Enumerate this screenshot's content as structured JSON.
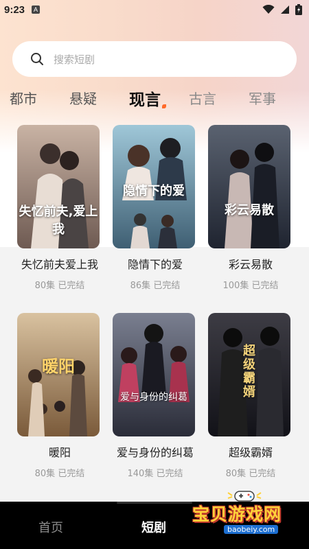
{
  "status_bar": {
    "time": "9:23",
    "app_badge": "A"
  },
  "search": {
    "placeholder": "搜索短剧"
  },
  "tabs": [
    {
      "label": "都市"
    },
    {
      "label": "悬疑"
    },
    {
      "label": "现言",
      "active": true
    },
    {
      "label": "古言"
    },
    {
      "label": "军事"
    }
  ],
  "dramas": [
    {
      "title": "失忆前夫爱上我",
      "episodes": "80集",
      "status": "已完结",
      "poster_text": "失忆前夫,爱上我",
      "colors": [
        "#c9b3a4",
        "#6e5a52"
      ]
    },
    {
      "title": "隐情下的爱",
      "episodes": "86集",
      "status": "已完结",
      "poster_text": "隐情下的爱",
      "colors": [
        "#9fc7d8",
        "#3f5f73"
      ]
    },
    {
      "title": "彩云易散",
      "episodes": "100集",
      "status": "已完结",
      "poster_text": "彩云易散",
      "colors": [
        "#5a6270",
        "#1f2430"
      ]
    },
    {
      "title": "暖阳",
      "episodes": "80集",
      "status": "已完结",
      "poster_text": "暖阳",
      "colors": [
        "#d9c2a0",
        "#7a5a3a"
      ]
    },
    {
      "title": "爱与身份的纠葛",
      "episodes": "140集",
      "status": "已完结",
      "poster_text": "爱与身份的纠葛",
      "colors": [
        "#7a7f90",
        "#2a2c38"
      ]
    },
    {
      "title": "超级霸婿",
      "episodes": "80集",
      "status": "已完结",
      "poster_text": "超级霸婿",
      "colors": [
        "#3d3c44",
        "#121218"
      ]
    }
  ],
  "bottom_nav": [
    {
      "label": "首页"
    },
    {
      "label": "短剧",
      "active": true
    }
  ],
  "watermark": {
    "text": "宝贝游戏网",
    "url": "baobeiy.com"
  }
}
